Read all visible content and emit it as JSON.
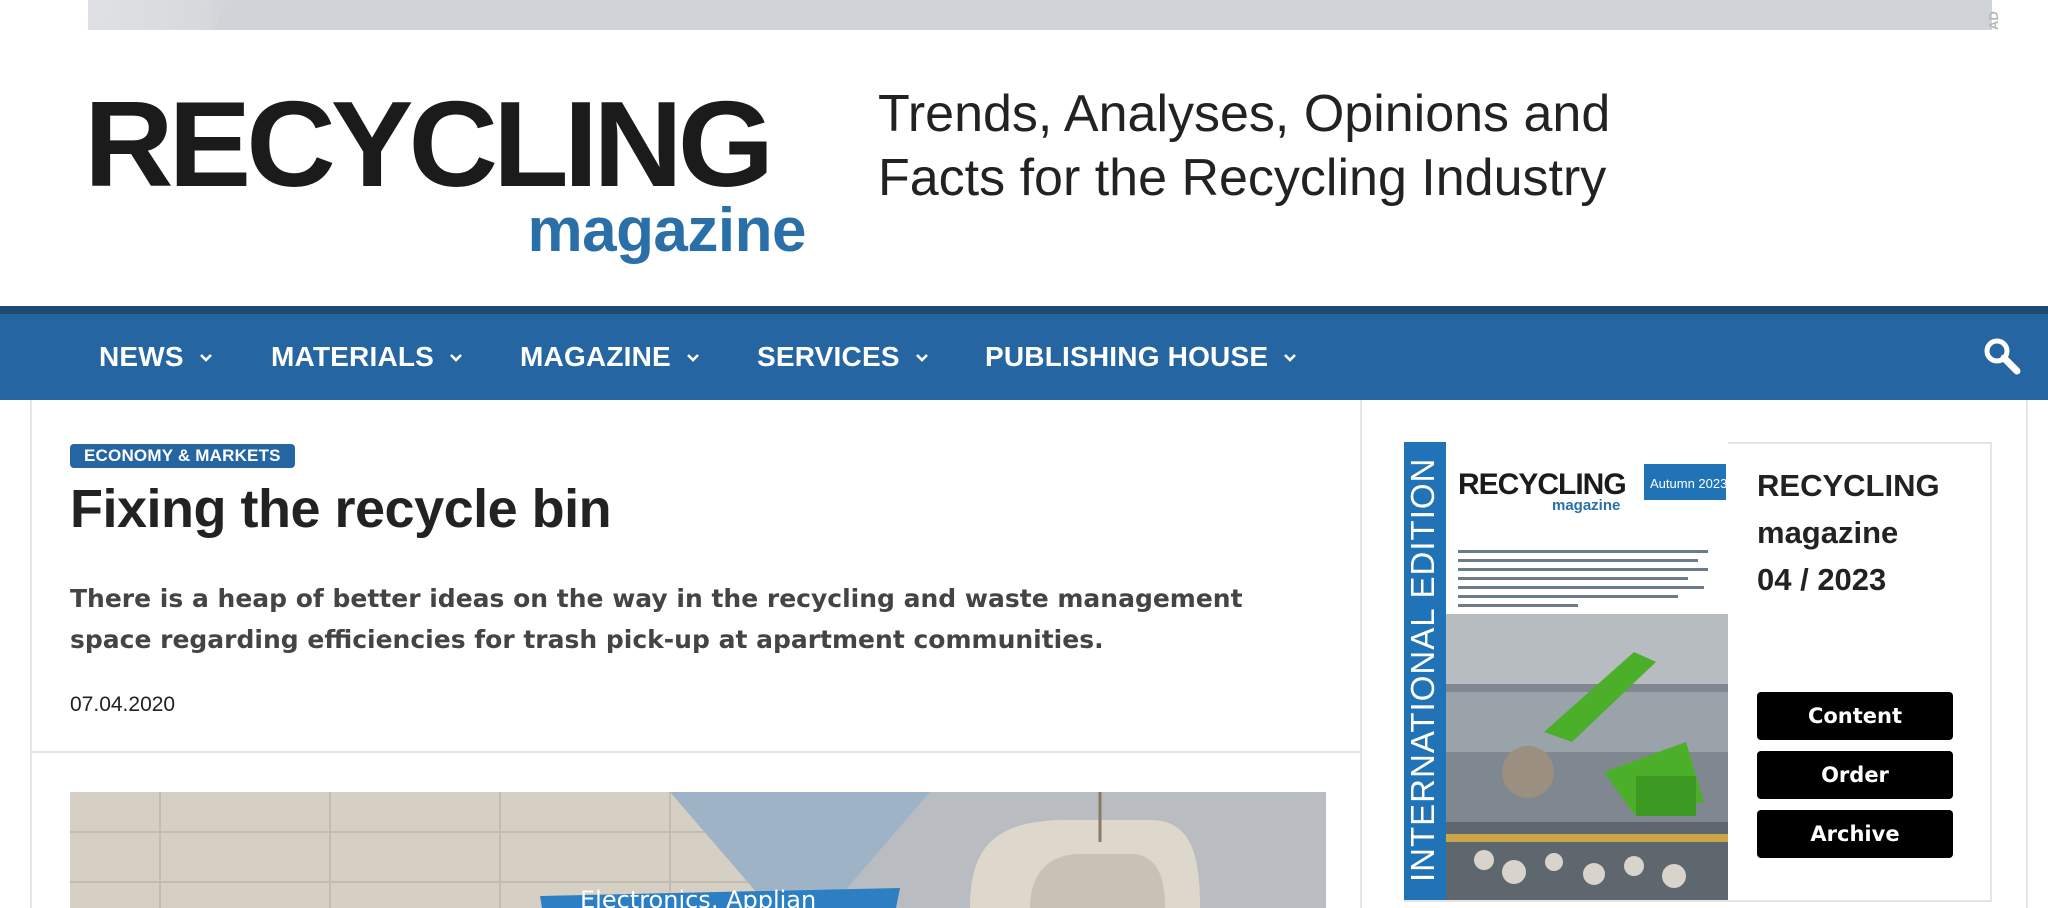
{
  "ad": {
    "tag": "AD"
  },
  "header": {
    "logo_main": "RECYCLING",
    "logo_sub": "magazine",
    "tagline_line1": "Trends, Analyses, Opinions and",
    "tagline_line2": "Facts for the Recycling Industry"
  },
  "nav": {
    "items": [
      {
        "label": "NEWS"
      },
      {
        "label": "MATERIALS"
      },
      {
        "label": "MAGAZINE"
      },
      {
        "label": "SERVICES"
      },
      {
        "label": "PUBLISHING HOUSE"
      }
    ],
    "search_icon": "search-icon"
  },
  "article": {
    "category": "ECONOMY & MARKETS",
    "title": "Fixing the recycle bin",
    "teaser": "There is a heap of better ideas on the way in the recycling and waste management space regarding efficiencies for trash pick-up at apartment communities.",
    "date": "07.04.2020",
    "photo_sign": "Electronics, Applian"
  },
  "sidebar": {
    "cover": {
      "edition": "INTERNATIONAL EDITION",
      "logo_main": "RECYCLING",
      "logo_sub": "magazine",
      "season": "Autumn 2023"
    },
    "title_line1": "RECYCLING",
    "title_line2": "magazine",
    "title_line3": "04 / 2023",
    "buttons": {
      "content": "Content",
      "order": "Order",
      "archive": "Archive"
    }
  },
  "colors": {
    "brand_blue": "#2465a2",
    "nav_border": "#1f4a72",
    "cover_green": "#4caf2a"
  }
}
